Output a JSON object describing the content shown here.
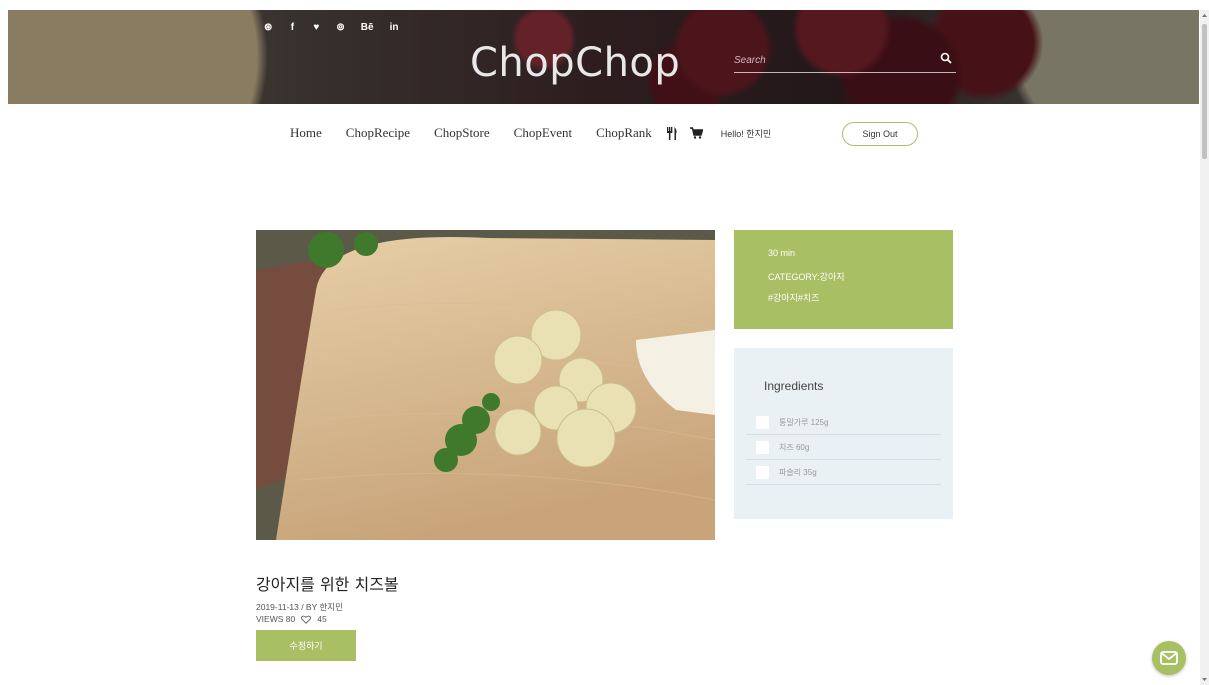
{
  "header": {
    "logo": "ChopChop",
    "social": [
      "⊛",
      "f",
      "♥",
      "⊚",
      "Bē",
      "in"
    ],
    "search_placeholder": "Search"
  },
  "nav": {
    "items": [
      "Home",
      "ChopRecipe",
      "ChopStore",
      "ChopEvent",
      "ChopRank"
    ],
    "greeting": "Hello! 한지민",
    "signout": "Sign Out"
  },
  "recipe": {
    "time": "30 min",
    "category": "CATEGORY:강아지",
    "tags": "#강아지#치즈",
    "ingredients_title": "Ingredients",
    "ingredients": [
      "통밀가루 125g",
      "치즈 60g",
      "파슬리 35g"
    ],
    "title": "강아지를 위한 치즈볼",
    "date_author": "2019-11-13  /  BY 한지민",
    "views": "VIEWS 80",
    "likes": "45",
    "edit_label": "수정하기"
  },
  "colors": {
    "accent": "#a9bf63",
    "ingredients_bg": "#e9f1f4"
  }
}
